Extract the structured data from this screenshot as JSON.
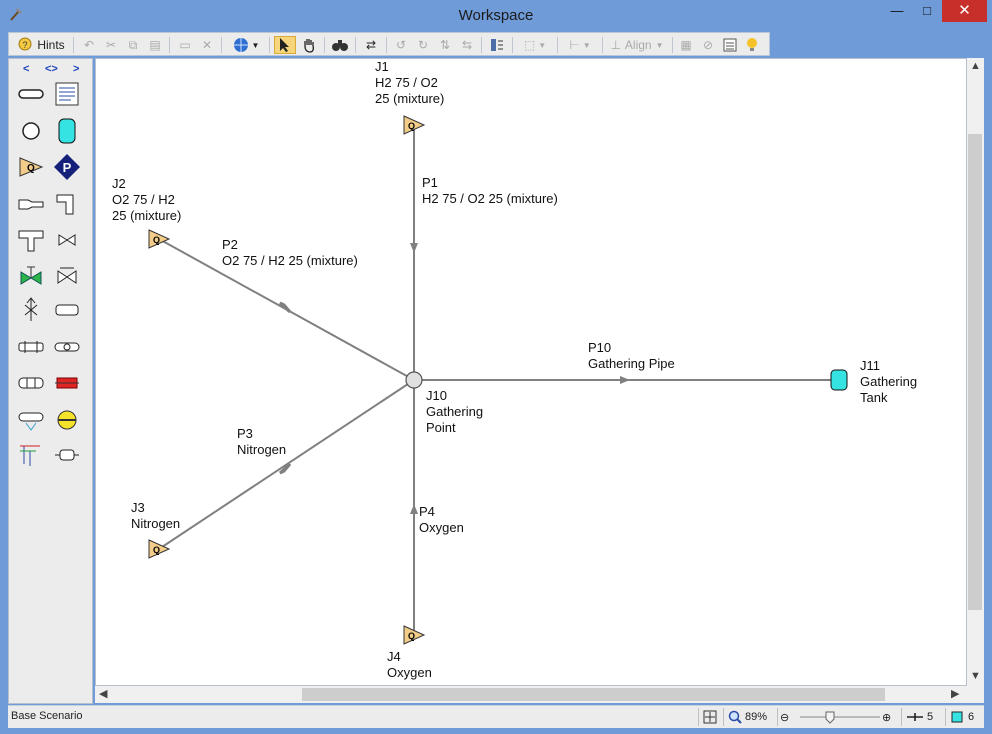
{
  "window": {
    "title": "Workspace",
    "minimize_glyph": "—",
    "maximize_glyph": "□",
    "close_glyph": "✕"
  },
  "toolbar": {
    "hints_label": "Hints",
    "align_label": "Align"
  },
  "palette": {
    "nav_prev": "<",
    "nav_both": "<>",
    "nav_next": ">"
  },
  "diagram": {
    "junctions": [
      {
        "id": "J1",
        "lines": [
          "J1",
          "H2 75 / O2",
          "25 (mixture)"
        ],
        "type": "assigned-flow"
      },
      {
        "id": "J2",
        "lines": [
          "J2",
          "O2 75 / H2",
          "25 (mixture)"
        ],
        "type": "assigned-flow"
      },
      {
        "id": "J3",
        "lines": [
          "J3",
          "Nitrogen"
        ],
        "type": "assigned-flow"
      },
      {
        "id": "J4",
        "lines": [
          "J4",
          "Oxygen"
        ],
        "type": "assigned-flow"
      },
      {
        "id": "J10",
        "lines": [
          "J10",
          "Gathering",
          "Point"
        ],
        "type": "branch"
      },
      {
        "id": "J11",
        "lines": [
          "J11",
          "Gathering",
          "Tank"
        ],
        "type": "tank"
      }
    ],
    "pipes": [
      {
        "id": "P1",
        "lines": [
          "P1",
          "H2 75 / O2 25 (mixture)"
        ]
      },
      {
        "id": "P2",
        "lines": [
          "P2",
          "O2 75 / H2 25 (mixture)"
        ]
      },
      {
        "id": "P3",
        "lines": [
          "P3",
          "Nitrogen"
        ]
      },
      {
        "id": "P4",
        "lines": [
          "P4",
          "Oxygen"
        ]
      },
      {
        "id": "P10",
        "lines": [
          "P10",
          "Gathering Pipe"
        ]
      }
    ],
    "junction_glyph": "Q"
  },
  "status": {
    "scenario": "Base Scenario",
    "zoom": "89%",
    "pipe_count": "5",
    "junction_count": "6"
  },
  "colors": {
    "titlebar": "#6f9bd8",
    "pipe": "#808080",
    "assigned_flow_fill": "#f3cc8a",
    "tank_fill": "#35e3e3",
    "pump_fill": "#14207a"
  }
}
